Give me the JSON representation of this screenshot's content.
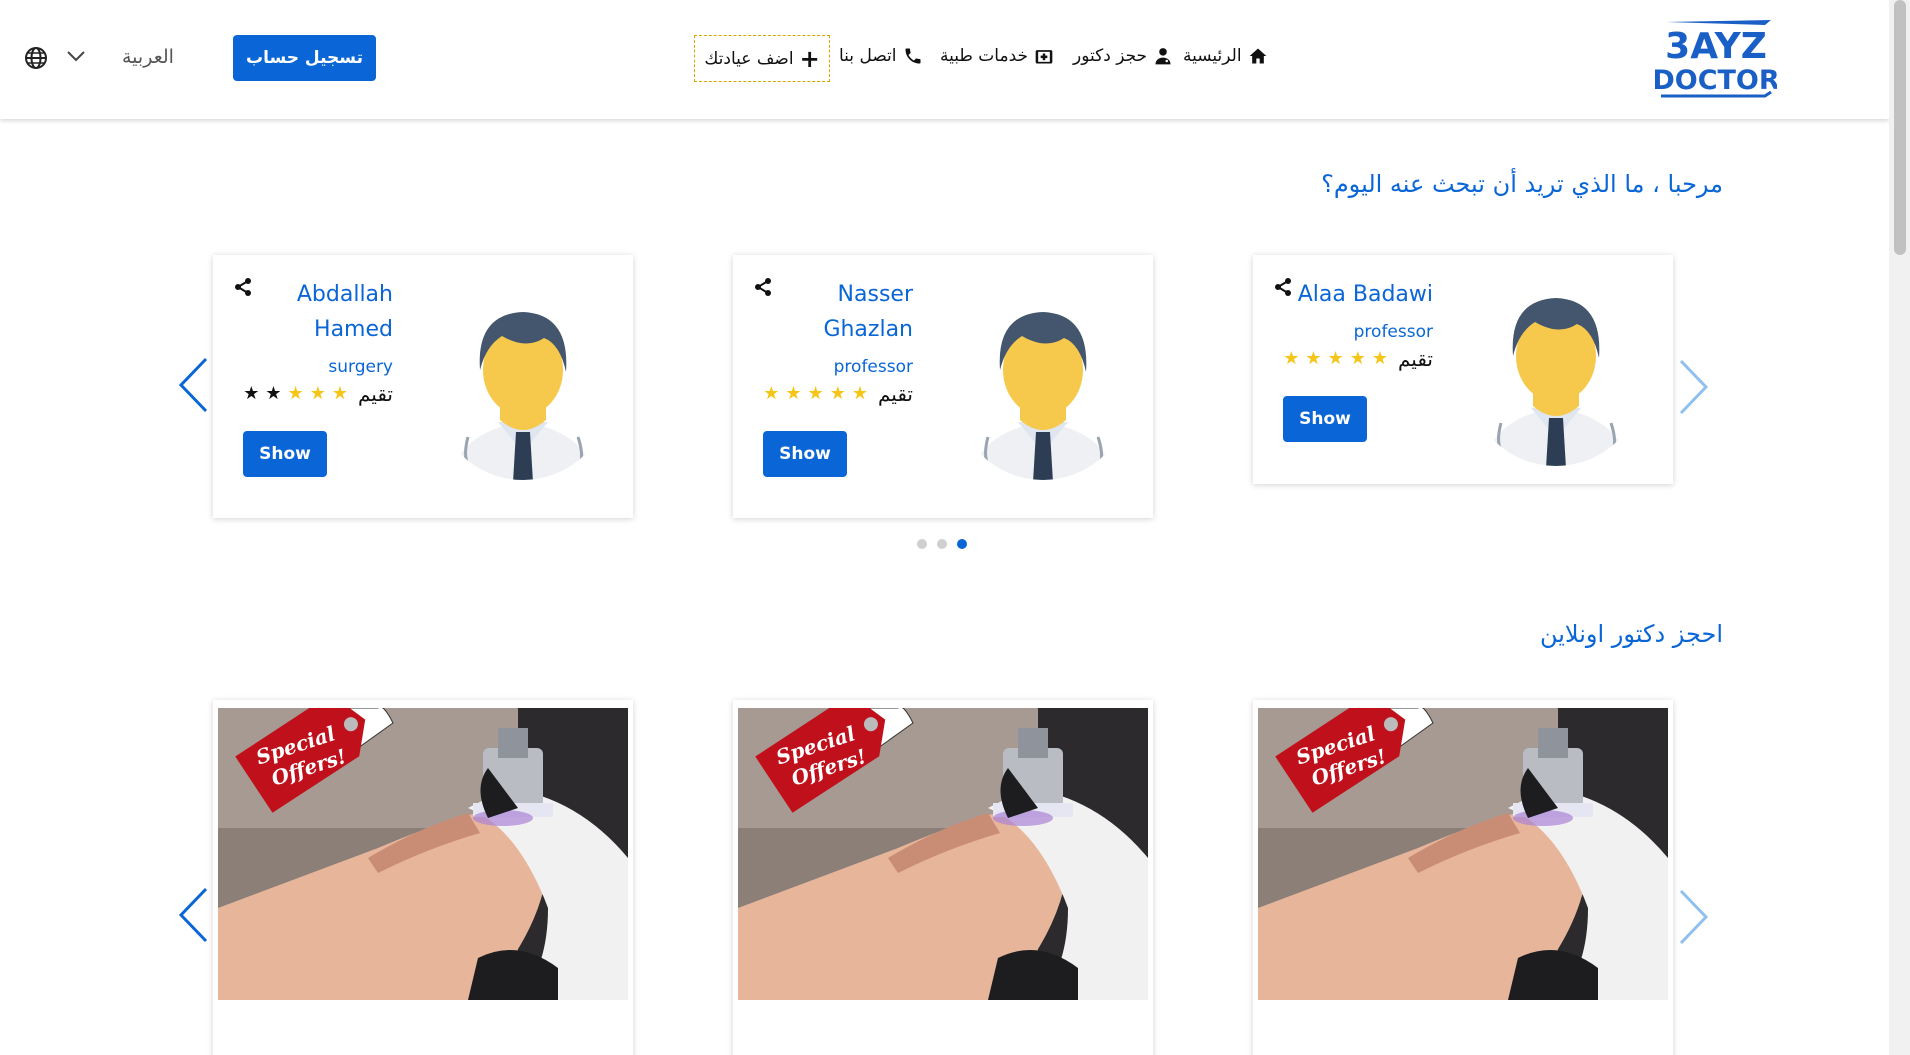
{
  "header": {
    "logo_line1": "3AYZ",
    "logo_line2": "DOCTOR",
    "nav": [
      {
        "label": "الرئيسية",
        "icon": "home-icon"
      },
      {
        "label": "حجز دكتور",
        "icon": "doctor-icon"
      },
      {
        "label": "خدمات طبية",
        "icon": "medical-kit-icon"
      },
      {
        "label": "اتصل بنا",
        "icon": "phone-icon"
      }
    ],
    "add_clinic": "اضف عيادتك",
    "register": "تسجيل حساب",
    "language": "العربية"
  },
  "greeting": "مرحبا ، ما الذي تريد أن تبحث عنه اليوم؟",
  "doctors": [
    {
      "name": "Alaa Badawi",
      "title": "professor",
      "rating_label": "تقيم",
      "stars": 5,
      "show_label": "Show"
    },
    {
      "name": "Nasser Ghazlan",
      "title": "professor",
      "rating_label": "تقيم",
      "stars": 5,
      "show_label": "Show"
    },
    {
      "name": "Abdallah Hamed",
      "title": "surgery",
      "rating_label": "تقيم",
      "stars": 3,
      "show_label": "Show"
    }
  ],
  "carousel_dots": 3,
  "active_dot": 3,
  "booking_title": "احجز دكتور اونلاين",
  "offers": [
    {
      "tag_line1": "Special",
      "tag_line2": "Offers!"
    },
    {
      "tag_line1": "Special",
      "tag_line2": "Offers!"
    },
    {
      "tag_line1": "Special",
      "tag_line2": "Offers!"
    }
  ],
  "colors": {
    "primary": "#0a66d6",
    "star": "#f5c518",
    "tag": "#c0101c"
  }
}
